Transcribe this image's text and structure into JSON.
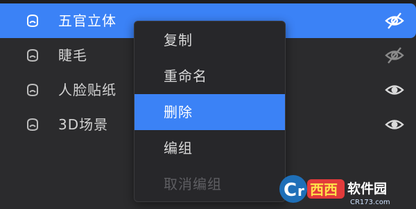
{
  "layers": [
    {
      "name": "五官立体",
      "selected": true,
      "visible": false
    },
    {
      "name": "睫毛",
      "selected": false,
      "visible": false
    },
    {
      "name": "人脸贴纸",
      "selected": false,
      "visible": true
    },
    {
      "name": "3D场景",
      "selected": false,
      "visible": true
    }
  ],
  "context_menu": {
    "items": [
      {
        "label": "复制",
        "state": "normal"
      },
      {
        "label": "重命名",
        "state": "normal"
      },
      {
        "label": "删除",
        "state": "active"
      },
      {
        "label": "编组",
        "state": "normal"
      },
      {
        "label": "取消编组",
        "state": "disabled"
      }
    ]
  },
  "watermark": {
    "brand": "西西软件园",
    "domain": "CR173.com"
  },
  "colors": {
    "background": "#2b2b2d",
    "accent": "#3b82f6",
    "menu_bg": "#27272a",
    "text": "#d3d3d3"
  },
  "icons": {
    "layer": "face-layer-icon",
    "visible": "eye-icon",
    "hidden": "eye-off-icon"
  }
}
